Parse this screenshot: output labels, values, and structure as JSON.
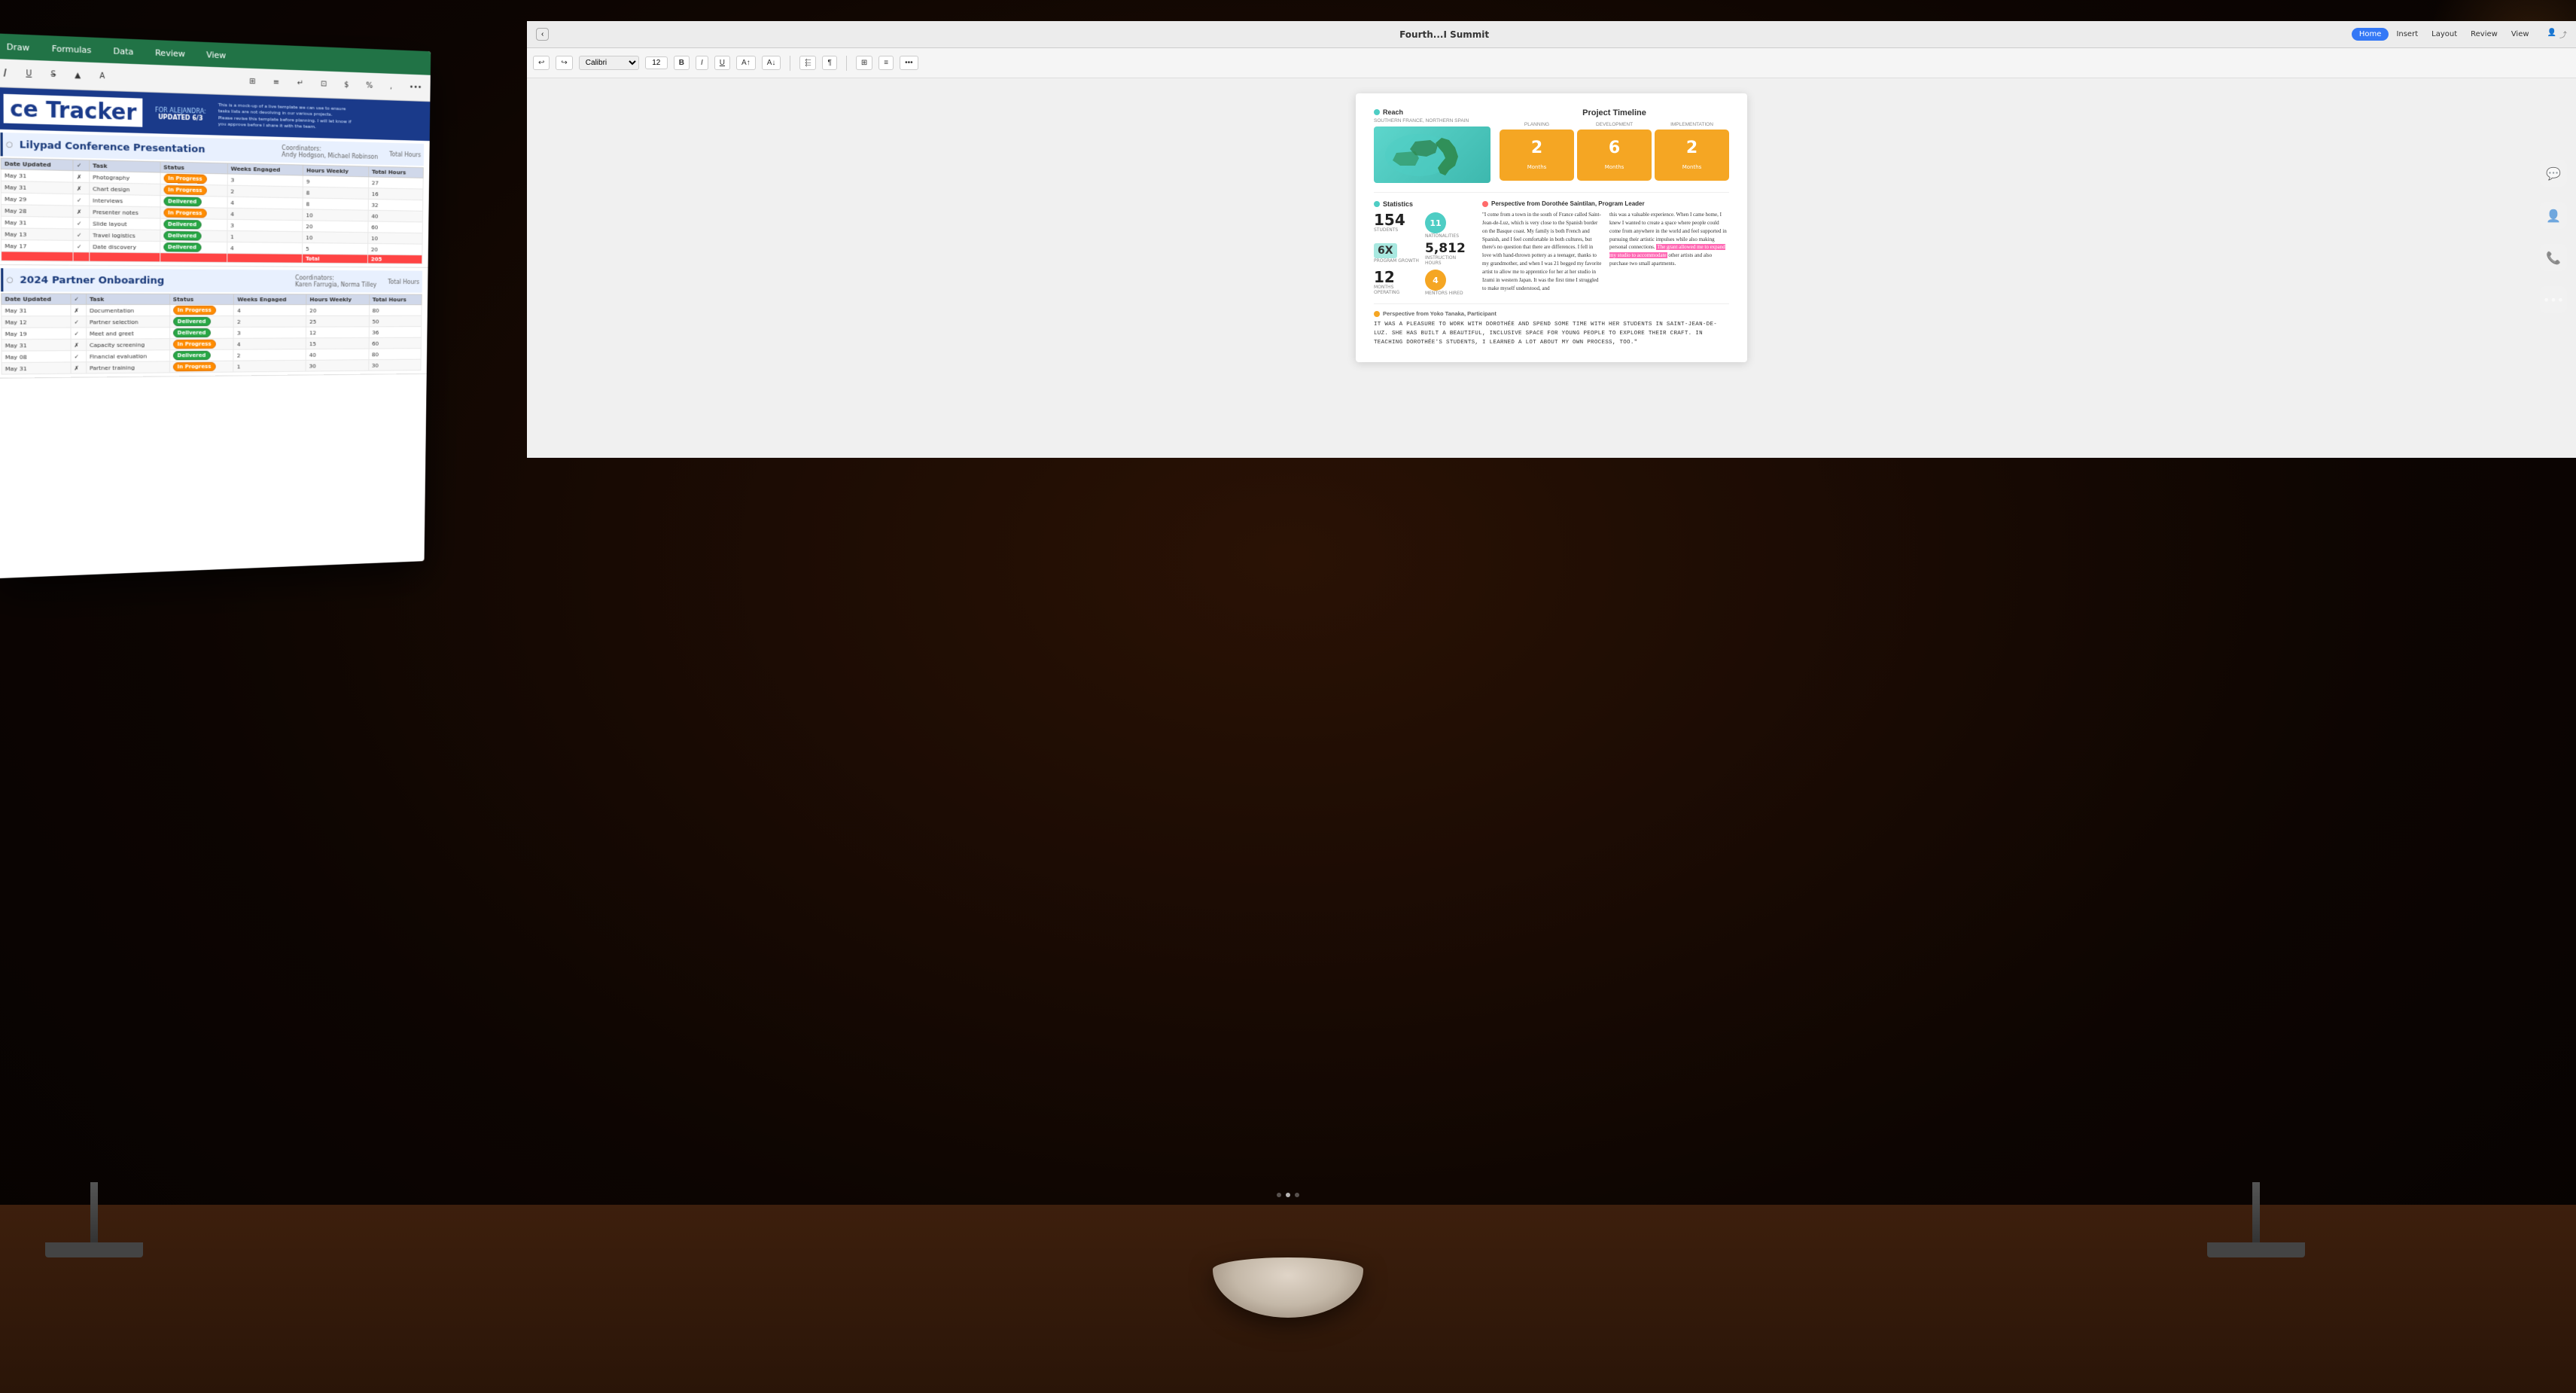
{
  "scene": {
    "bg_description": "Dark room with wooden desk"
  },
  "left_monitor": {
    "title": "ce Tracker",
    "subtitle_for": "FOR ALEJANDRA:",
    "subtitle_updated": "UPDATED 6/3",
    "tabs": [
      "Draw",
      "Formulas",
      "Data",
      "Review",
      "View"
    ],
    "sections": [
      {
        "name": "Lilypad Conference Presentation",
        "coordinators": "Andy Hodgson, Michael Robinson",
        "tasks": [
          {
            "date": "May 31",
            "check": "×",
            "task": "Photography",
            "status": "In Progress",
            "weeks": "3",
            "hours": "9",
            "total": "27"
          },
          {
            "date": "May 31",
            "check": "×",
            "task": "Chart design",
            "status": "In Progress",
            "weeks": "2",
            "hours": "8",
            "total": "16"
          },
          {
            "date": "May 29",
            "check": "✓",
            "task": "Interviews",
            "status": "Delivered",
            "weeks": "4",
            "hours": "8",
            "total": "32"
          },
          {
            "date": "May 28",
            "check": "×",
            "task": "Presenter notes",
            "status": "In Progress",
            "weeks": "4",
            "hours": "10",
            "total": "40"
          },
          {
            "date": "May 31",
            "check": "✓",
            "task": "Slide layout",
            "status": "Delivered",
            "weeks": "3",
            "hours": "20",
            "total": "60"
          },
          {
            "date": "May 13",
            "check": "✓",
            "task": "Travel logistics",
            "status": "Delivered",
            "weeks": "1",
            "hours": "10",
            "total": "10"
          },
          {
            "date": "May 17",
            "check": "✓",
            "task": "Date discovery",
            "status": "Delivered",
            "weeks": "4",
            "hours": "5",
            "total": "20"
          },
          {
            "date": "",
            "check": "",
            "task": "Total",
            "status": "",
            "weeks": "",
            "hours": "",
            "total": "205"
          }
        ]
      },
      {
        "name": "2024 Partner Onboarding",
        "coordinators": "Karen Farrugia, Norma Tilley",
        "tasks": [
          {
            "date": "May 31",
            "check": "×",
            "task": "Documentation",
            "status": "In Progress",
            "weeks": "4",
            "hours": "20",
            "total": "80"
          },
          {
            "date": "May 12",
            "check": "✓",
            "task": "Partner selection",
            "status": "Delivered",
            "weeks": "2",
            "hours": "25",
            "total": "50"
          },
          {
            "date": "May 19",
            "check": "✓",
            "task": "Meet and greet",
            "status": "Delivered",
            "weeks": "3",
            "hours": "12",
            "total": "36"
          },
          {
            "date": "May 31",
            "check": "×",
            "task": "Capacity screening",
            "status": "In Progress",
            "weeks": "4",
            "hours": "15",
            "total": "60"
          },
          {
            "date": "May 08",
            "check": "✓",
            "task": "Financial evaluation",
            "status": "Delivered",
            "weeks": "2",
            "hours": "40",
            "total": "80"
          },
          {
            "date": "May 31",
            "check": "×",
            "task": "Partner training",
            "status": "In Progress",
            "weeks": "1",
            "hours": "30",
            "total": "30"
          }
        ]
      }
    ]
  },
  "right_doc": {
    "reach": {
      "label": "Reach",
      "sublabel": "SOUTHERN FRANCE, NORTHERN SPAIN"
    },
    "project_timeline": {
      "title": "Project Timeline",
      "phases": [
        {
          "label": "PLANNING",
          "months": "2",
          "unit": "Months"
        },
        {
          "label": "DEVELOPMENT",
          "months": "6",
          "unit": "Months"
        },
        {
          "label": "IMPLEMENTATION",
          "months": "2",
          "unit": "Months"
        }
      ]
    },
    "statistics": {
      "title": "Statistics",
      "items": [
        {
          "value": "154",
          "label": "STUDENTS",
          "type": "plain"
        },
        {
          "value": "11",
          "label": "NATIONALITIES",
          "type": "teal-badge"
        },
        {
          "value": "6X",
          "label": "PROGRAM GROWTH",
          "type": "teal-box"
        },
        {
          "value": "5,812",
          "label": "INSTRUCTION HOURS",
          "type": "plain"
        },
        {
          "value": "12",
          "label": "MONTHS OPERATING",
          "type": "plain"
        },
        {
          "value": "4",
          "label": "MENTORS HIRED",
          "type": "orange-badge"
        }
      ]
    },
    "perspective_dorothee": {
      "title": "Perspective from Dorothée Saintilan, Program Leader",
      "col1": "\"I come from a town in the south of France called Saint-Jean-de-Luz, which is very close to the Spanish border on the Basque coast. My family is both French and Spanish, and I feel comfortable in both cultures, but there's no question that there are differences. I fell in love with hand-thrown pottery as a teenager, thanks to my grandmother, and when I was 21 begged my favorite artist to allow me to apprentice for her at her studio in Izumi in western Japan. It was the first time I struggled to make myself understood, and",
      "col2": "this was a valuable experience. When I came home, I knew I wanted to create a space where people could come from anywhere in the world and feel supported in pursuing their artistic impulses while also making personal connections. The grant allowed me to expand my studio to accommodate other artists and also purchase two small apartments.",
      "highlight": "The grant allowed me to expand my studio to accommodate"
    },
    "perspective_yoko": {
      "title": "Perspective from Yoko Tanaka, Participant",
      "text": "IT WAS A PLEASURE TO WORK WITH DOROTHÉE AND SPEND SOME TIME WITH HER STUDENTS IN SAINT-JEAN-DE-LUZ. SHE HAS BUILT A BEAUTIFUL, INCLUSIVE SPACE FOR YOUNG PEOPLE TO EXPLORE THEIR CRAFT. IN TEACHING DOROTHÉE'S STUDENTS, I LEARNED A LOT ABOUT MY OWN PROCESS, TOO.\""
    }
  },
  "numbers_app": {
    "title": "Fourth...I Summit",
    "tabs": [
      "Home",
      "Insert",
      "Layout",
      "Review",
      "View"
    ],
    "active_tab": "Home",
    "font": "Calibri",
    "font_size": "12",
    "toolbar_buttons": [
      "B",
      "I",
      "U"
    ]
  }
}
